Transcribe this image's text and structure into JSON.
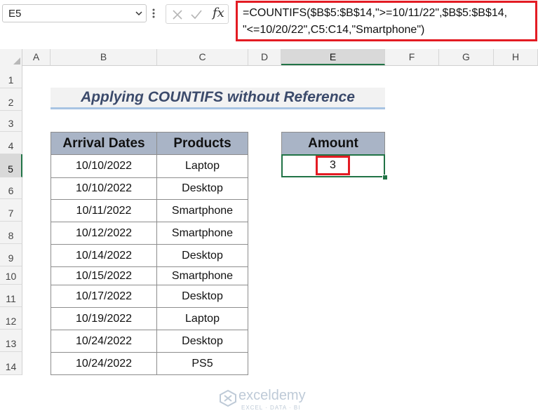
{
  "formula_bar": {
    "name_box": "E5",
    "fx_label": "fx",
    "formula_line1": "=COUNTIFS($B$5:$B$14,\">=10/11/22\",$B$5:$B$14,",
    "formula_line2": "\"<=10/20/22\",C5:C14,\"Smartphone\")"
  },
  "columns": [
    "A",
    "B",
    "C",
    "D",
    "E",
    "F",
    "G",
    "H"
  ],
  "selected_column": "E",
  "rows": [
    "1",
    "2",
    "3",
    "4",
    "5",
    "6",
    "7",
    "8",
    "9",
    "10",
    "11",
    "12",
    "13",
    "14"
  ],
  "selected_row": "5",
  "sheet": {
    "title": "Applying COUNTIFS without Reference",
    "table_headers": {
      "dates": "Arrival Dates",
      "products": "Products"
    },
    "records": [
      {
        "date": "10/10/2022",
        "product": "Laptop"
      },
      {
        "date": "10/10/2022",
        "product": "Desktop"
      },
      {
        "date": "10/11/2022",
        "product": "Smartphone"
      },
      {
        "date": "10/12/2022",
        "product": "Smartphone"
      },
      {
        "date": "10/14/2022",
        "product": "Desktop"
      },
      {
        "date": "10/15/2022",
        "product": "Smartphone"
      },
      {
        "date": "10/17/2022",
        "product": "Desktop"
      },
      {
        "date": "10/19/2022",
        "product": "Laptop"
      },
      {
        "date": "10/24/2022",
        "product": "Desktop"
      },
      {
        "date": "10/24/2022",
        "product": "PS5"
      }
    ],
    "amount_header": "Amount",
    "amount_value": "3"
  },
  "watermark": {
    "name": "exceldemy",
    "tagline": "EXCEL · DATA · BI"
  },
  "colors": {
    "accent_green": "#217346",
    "highlight_red": "#e31b23",
    "header_fill": "#a9b4c6"
  }
}
